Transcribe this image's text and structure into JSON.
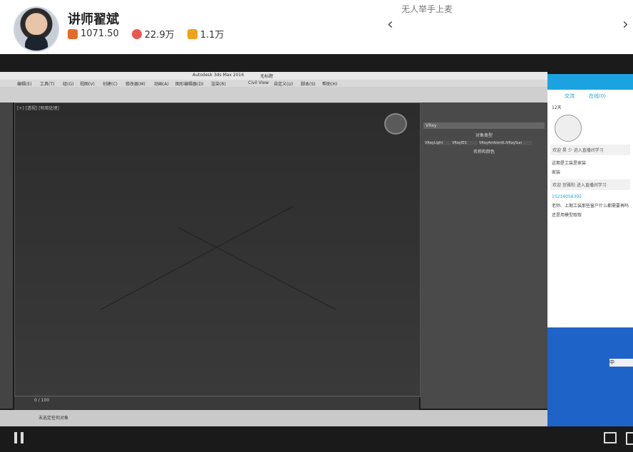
{
  "header": {
    "name": "讲师翟斌",
    "stats": [
      {
        "icon": "gift-box-icon",
        "value": "1071.50",
        "color": "#e46a2c"
      },
      {
        "icon": "flower-icon",
        "value": "22.9万",
        "color": "#e85a4f"
      },
      {
        "icon": "hammer-icon",
        "value": "1.1万",
        "color": "#f0a21a"
      }
    ],
    "notice": "无人举手上麦"
  },
  "screen": {
    "app_title": "Autodesk 3ds Max 2016",
    "file_name": "无标题",
    "menu_items": [
      "编辑(E)",
      "工具(T)",
      "组(G)",
      "视图(V)",
      "创建(C)",
      "修改器(M)",
      "动画(A)",
      "图形编辑器(D)",
      "渲染(R)",
      "Civil View",
      "自定义(U)",
      "脚本(S)",
      "帮助(H)"
    ],
    "viewport_label": "[+] [透视] [明暗处理]",
    "panel_renderer": "VRay",
    "panel_object_type": "对象类型",
    "panel_name_color": "名称和颜色",
    "panel_buttons": [
      "VRayLight",
      "VRayIES",
      "VRayAmbientLight",
      "VRaySun"
    ],
    "timeline_range": "0 / 100",
    "status_text": "未选定任何对象",
    "chat": {
      "tabs": [
        "交流",
        "在线(0)"
      ],
      "messages": [
        "12天",
        "欢迎 昊 少 进入直播间学习",
        "这期是工装是家装",
        "家装",
        "欢迎 宫雅阳 进入直播间学习",
        "15214056305",
        "老师、上期工装那些窗户什么都需要再吗",
        "还是用模型取取"
      ]
    },
    "ime": "中"
  }
}
